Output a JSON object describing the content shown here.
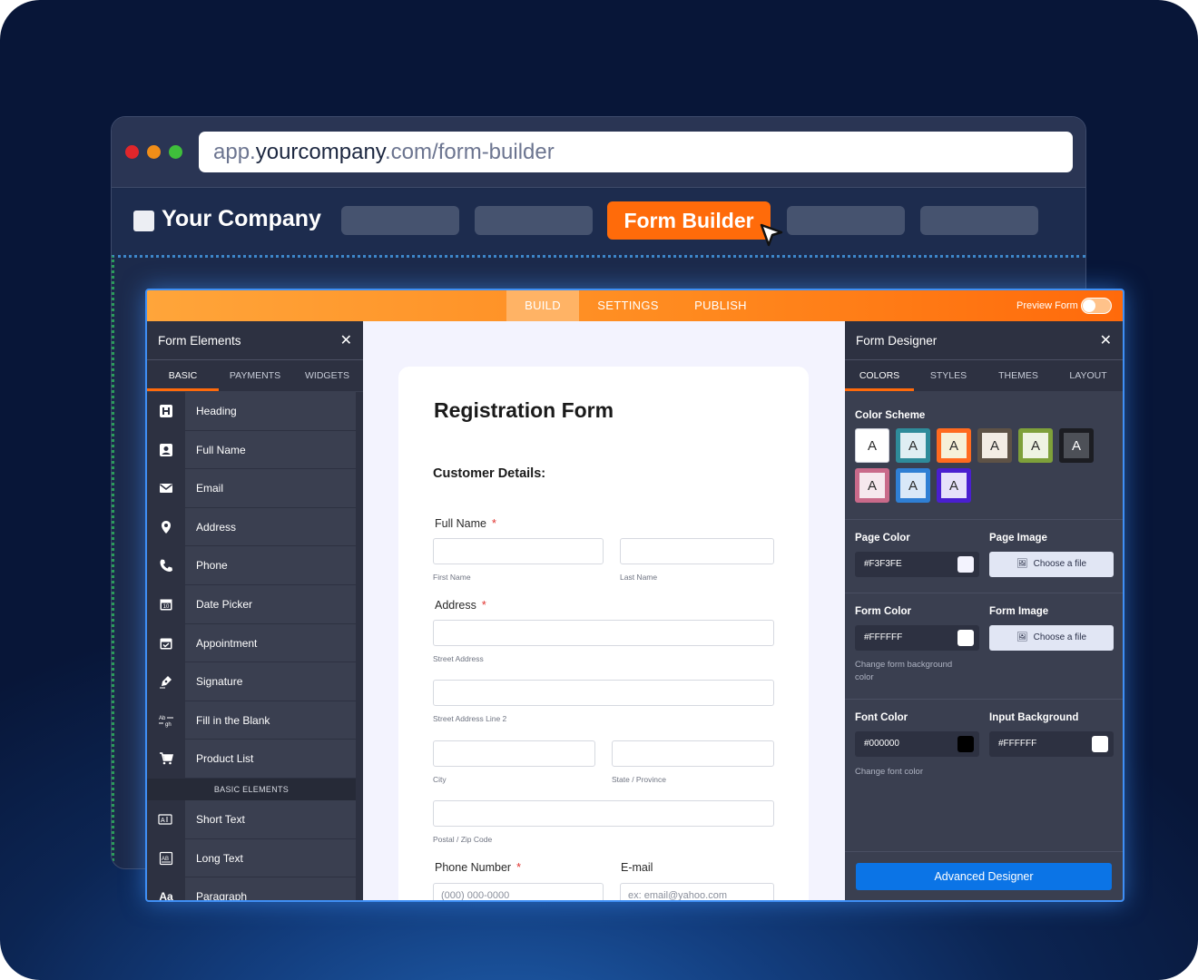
{
  "browser": {
    "url_prefix": "app.",
    "url_host": "yourcompany",
    "url_suffix": ".com/form-builder"
  },
  "appnav": {
    "company_name": "Your Company",
    "active_tab": "Form Builder"
  },
  "topbar": {
    "tabs": [
      "BUILD",
      "SETTINGS",
      "PUBLISH"
    ],
    "preview_label": "Preview Form"
  },
  "left_panel": {
    "title": "Form Elements",
    "tabs": [
      "BASIC",
      "PAYMENTS",
      "WIDGETS"
    ],
    "items": [
      {
        "label": "Heading",
        "icon": "heading-icon"
      },
      {
        "label": "Full Name",
        "icon": "person-icon"
      },
      {
        "label": "Email",
        "icon": "envelope-icon"
      },
      {
        "label": "Address",
        "icon": "map-pin-icon"
      },
      {
        "label": "Phone",
        "icon": "phone-icon"
      },
      {
        "label": "Date Picker",
        "icon": "calendar-icon"
      },
      {
        "label": "Appointment",
        "icon": "calendar-check-icon"
      },
      {
        "label": "Signature",
        "icon": "pen-icon"
      },
      {
        "label": "Fill in the Blank",
        "icon": "fill-blank-icon"
      },
      {
        "label": "Product List",
        "icon": "cart-icon"
      }
    ],
    "section_label": "BASIC ELEMENTS",
    "items2": [
      {
        "label": "Short Text",
        "icon": "short-text-icon"
      },
      {
        "label": "Long Text",
        "icon": "long-text-icon"
      },
      {
        "label": "Paragraph",
        "icon": "paragraph-icon"
      }
    ]
  },
  "form": {
    "title": "Registration Form",
    "section_title": "Customer Details:",
    "full_name_label": "Full Name",
    "first_name_help": "First Name",
    "last_name_help": "Last Name",
    "address_label": "Address",
    "street_help": "Street Address",
    "street2_help": "Street Address Line 2",
    "city_help": "City",
    "state_help": "State / Province",
    "zip_help": "Postal / Zip Code",
    "phone_label": "Phone Number",
    "phone_placeholder": "(000) 000-0000",
    "email_label": "E-mail",
    "email_placeholder": "ex: email@yahoo.com",
    "required_mark": "*"
  },
  "right_panel": {
    "title": "Form Designer",
    "tabs": [
      "COLORS",
      "STYLES",
      "THEMES",
      "LAYOUT"
    ],
    "color_scheme_label": "Color Scheme",
    "swatch_letter": "A",
    "swatches": [
      {
        "outer": "#ffffff",
        "inner": "#ffffff"
      },
      {
        "outer": "#2e8b9a",
        "inner": "#dfeef3"
      },
      {
        "outer": "#ff6a1f",
        "inner": "#f6f0d8"
      },
      {
        "outer": "#5e5246",
        "inner": "#f3ece4"
      },
      {
        "outer": "#7ea03a",
        "inner": "#eef3e2"
      },
      {
        "outer": "#1c1d22",
        "inner": "#4d5057"
      },
      {
        "outer": "#c96a8a",
        "inner": "#f6e8ee"
      },
      {
        "outer": "#2f7fd4",
        "inner": "#d9e8f8"
      },
      {
        "outer": "#4a1fd0",
        "inner": "#e6e1fa"
      }
    ],
    "page_color_label": "Page Color",
    "page_color_value": "#F3F3FE",
    "page_image_label": "Page Image",
    "choose_file": "Choose a file",
    "form_color_label": "Form Color",
    "form_color_value": "#FFFFFF",
    "form_color_help": "Change form background color",
    "form_image_label": "Form Image",
    "font_color_label": "Font Color",
    "font_color_value": "#000000",
    "font_color_help": "Change font color",
    "input_bg_label": "Input Background",
    "input_bg_value": "#FFFFFF",
    "advanced_button": "Advanced Designer"
  },
  "colors": {
    "accent_orange": "#ff6a0b",
    "accent_blue": "#0b74e6",
    "panel_dark": "#3a3f50"
  }
}
